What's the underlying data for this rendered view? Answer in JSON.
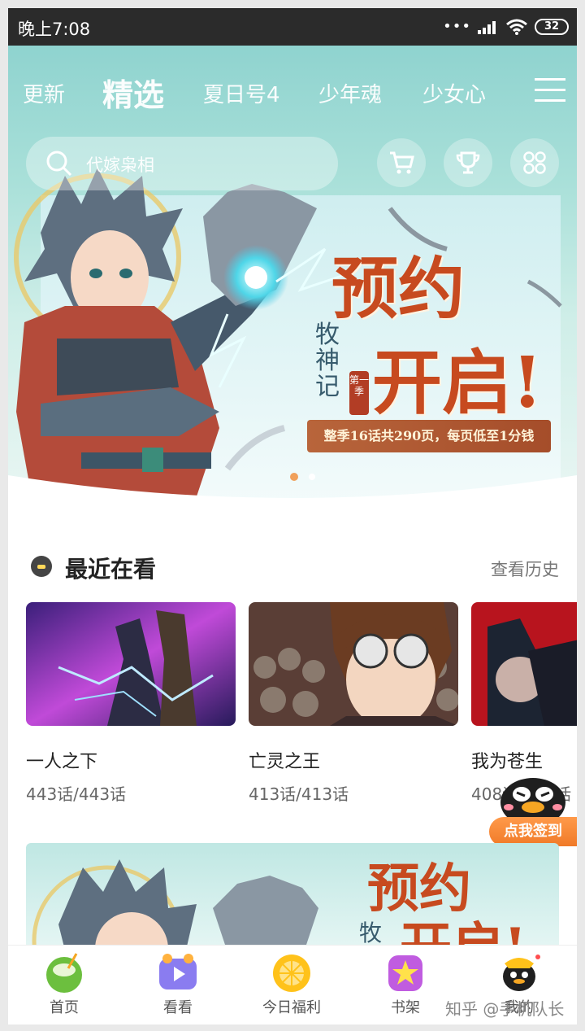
{
  "status_bar": {
    "time": "晚上7:08",
    "signal_dots": "•••",
    "battery": "32"
  },
  "top_tabs": [
    {
      "label": "更新",
      "active": false
    },
    {
      "label": "精选",
      "active": true
    },
    {
      "label": "夏日号4",
      "active": false
    },
    {
      "label": "少年魂",
      "active": false
    },
    {
      "label": "少女心",
      "active": false
    }
  ],
  "search": {
    "placeholder": "代嫁枭相"
  },
  "header_icons": [
    "cart-icon",
    "trophy-icon",
    "grid-icon"
  ],
  "hero_banner": {
    "headline_line1": "预约",
    "headline_line2": "开启!",
    "comic_title": "牧神记",
    "season_tag": "第一季",
    "promo_text": "整季16话共290页，每页低至1分钱"
  },
  "recent": {
    "title": "最近在看",
    "history_link": "查看历史",
    "items": [
      {
        "name": "一人之下",
        "progress": "443话/443话"
      },
      {
        "name": "亡灵之王",
        "progress": "413话/413话"
      },
      {
        "name": "我为苍生",
        "progress": "408话/413话"
      }
    ]
  },
  "checkin": {
    "label": "点我签到"
  },
  "bottom_nav": [
    {
      "label": "首页",
      "icon": "coconut-icon"
    },
    {
      "label": "看看",
      "icon": "video-icon"
    },
    {
      "label": "今日福利",
      "icon": "orange-icon"
    },
    {
      "label": "书架",
      "icon": "star-icon"
    },
    {
      "label": "我的",
      "icon": "penguin-icon"
    }
  ],
  "watermark": "知乎 @手机队长",
  "colors": {
    "accent_teal": "#8fd3cf",
    "promo_red": "#c74a1f",
    "checkin_orange": "#f07a28"
  }
}
